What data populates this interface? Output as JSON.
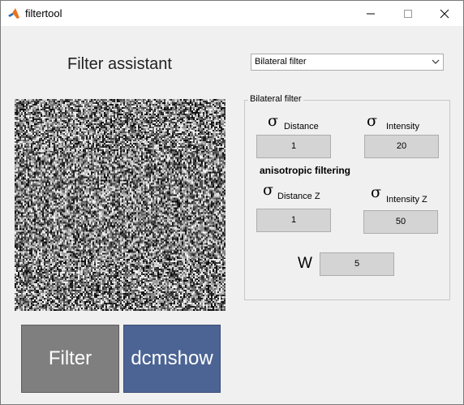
{
  "window": {
    "title": "filtertool",
    "icon": "matlab-icon"
  },
  "heading": "Filter assistant",
  "filter_select": {
    "selected": "Bilateral filter"
  },
  "panel": {
    "title": "Bilateral filter",
    "sigma_symbol": "σ",
    "sigma_distance_sub": "Distance",
    "sigma_intensity_sub": "Intensity",
    "anisotropic_label": "anisotropic filtering",
    "sigma_distance_z_sub": "Distance Z",
    "sigma_intensity_z_sub": "Intensity Z",
    "w_label": "W",
    "sigma_distance_value": "1",
    "sigma_intensity_value": "20",
    "sigma_distance_z_value": "1",
    "sigma_intensity_z_value": "50",
    "w_value": "5"
  },
  "buttons": {
    "filter_label": "Filter",
    "dcmshow_label": "dcmshow"
  },
  "colors": {
    "filter_button": "#7f7f7f",
    "dcmshow_button": "#4c6494",
    "field_background": "#d4d4d4"
  }
}
